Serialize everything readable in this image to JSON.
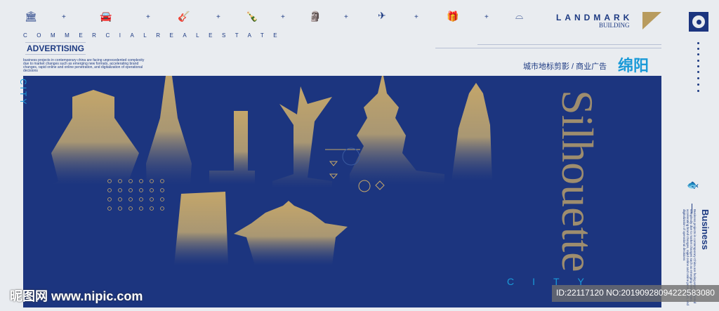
{
  "header": {
    "icons": [
      "bank-icon",
      "car-icon",
      "guitar-icon",
      "bottle-icon",
      "statue-icon",
      "airplane-icon",
      "gift-icon",
      "bowl-icon"
    ],
    "tagline": "COMMERCIALREALESTATE",
    "advertising": "ADVERTISING",
    "description": "business projects in contemporary china are facing unprecedented complexity due to market changes such as  emerging new formats, accelerating brand changes, rapid online and online penetration, and digitalization of operational decisions",
    "landmark": "LANDMARK",
    "building": "BUILDING"
  },
  "title": {
    "subtitle": "城市地标剪影 / 商业广告",
    "city": "绵阳"
  },
  "poster": {
    "silhouette_text": "Silhouette",
    "vertical_city": "CITY",
    "bottom_city": "CITY",
    "colors": {
      "panel": "#1c357f",
      "gold": "#b89b5e",
      "accent": "#1a9ad8"
    }
  },
  "side": {
    "business": "Business",
    "business_text": "Business projects in contemporary China are facing unprecedented complexity due to market changes such as emerging new formats, accelerating brand changes, rapid online and online penetration, and digitalization of operational decisions"
  },
  "watermark": {
    "site": "昵图网 www.nipic.com",
    "id": "ID:22117120 NO:20190928094222583080"
  }
}
